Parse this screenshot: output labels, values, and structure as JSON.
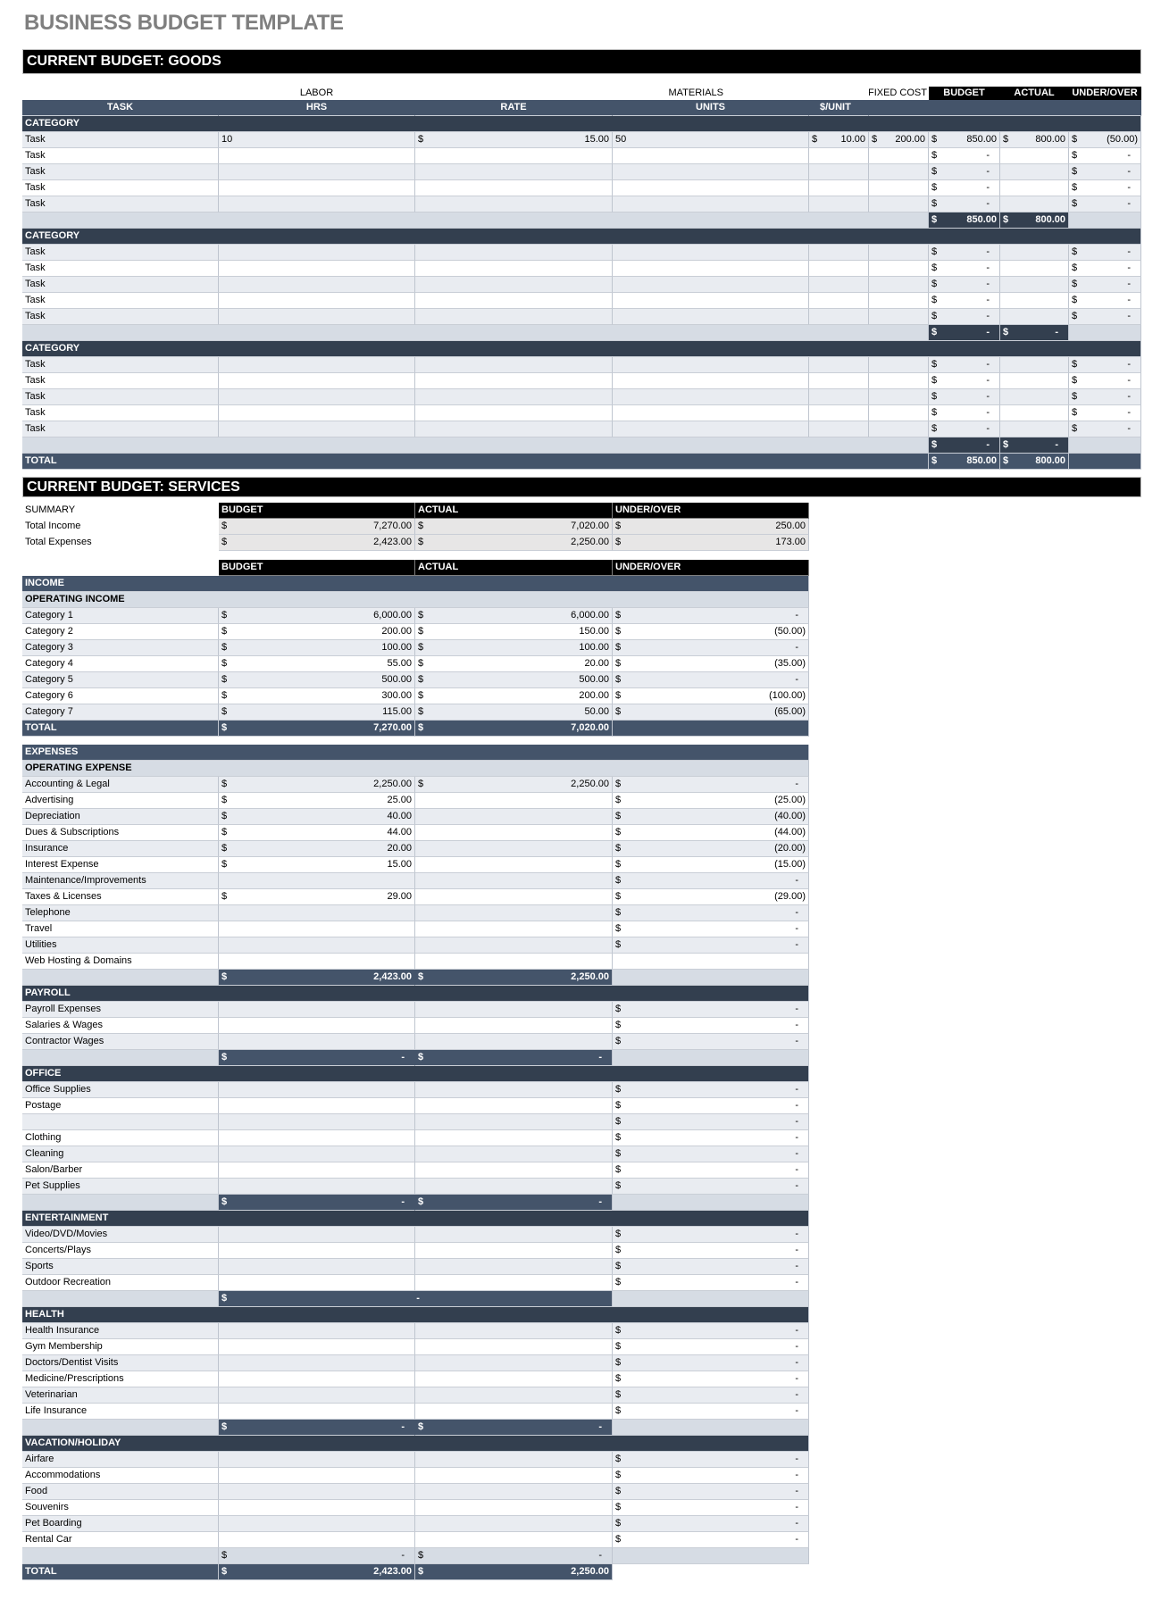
{
  "title": "BUSINESS BUDGET TEMPLATE",
  "goods": {
    "section_title": "CURRENT BUDGET: GOODS",
    "group_labels": {
      "labor": "LABOR",
      "materials": "MATERIALS",
      "fixed_cost": "FIXED COST",
      "budget": "BUDGET",
      "actual": "ACTUAL",
      "under_over": "UNDER/OVER"
    },
    "columns": {
      "task": "TASK",
      "hrs": "HRS",
      "rate": "RATE",
      "units": "UNITS",
      "per_unit": "$/UNIT"
    },
    "categories": [
      {
        "label": "CATEGORY",
        "tasks": [
          {
            "task": "Task",
            "hrs": "10",
            "rate": "15.00",
            "units": "50",
            "per_unit": "10.00",
            "fixed": "200.00",
            "budget": "850.00",
            "actual": "800.00",
            "under_over": "(50.00)"
          },
          {
            "task": "Task",
            "budget": "-",
            "under_over": "-"
          },
          {
            "task": "Task",
            "budget": "-",
            "under_over": "-"
          },
          {
            "task": "Task",
            "budget": "-",
            "under_over": "-"
          },
          {
            "task": "Task",
            "budget": "-",
            "under_over": "-"
          }
        ],
        "subtotal": {
          "budget": "850.00",
          "actual": "800.00"
        }
      },
      {
        "label": "CATEGORY",
        "tasks": [
          {
            "task": "Task",
            "budget": "-",
            "under_over": "-"
          },
          {
            "task": "Task",
            "budget": "-",
            "under_over": "-"
          },
          {
            "task": "Task",
            "budget": "-",
            "under_over": "-"
          },
          {
            "task": "Task",
            "budget": "-",
            "under_over": "-"
          },
          {
            "task": "Task",
            "budget": "-",
            "under_over": "-"
          }
        ],
        "subtotal": {
          "budget": "-",
          "actual": "-"
        }
      },
      {
        "label": "CATEGORY",
        "tasks": [
          {
            "task": "Task",
            "budget": "-",
            "under_over": "-"
          },
          {
            "task": "Task",
            "budget": "-",
            "under_over": "-"
          },
          {
            "task": "Task",
            "budget": "-",
            "under_over": "-"
          },
          {
            "task": "Task",
            "budget": "-",
            "under_over": "-"
          },
          {
            "task": "Task",
            "budget": "-",
            "under_over": "-"
          }
        ],
        "subtotal": {
          "budget": "-",
          "actual": "-"
        }
      }
    ],
    "total": {
      "label": "TOTAL",
      "budget": "850.00",
      "actual": "800.00"
    }
  },
  "services": {
    "section_title": "CURRENT BUDGET: SERVICES",
    "currency": "$",
    "summary": {
      "label": "SUMMARY",
      "headers": {
        "budget": "BUDGET",
        "actual": "ACTUAL",
        "under_over": "UNDER/OVER"
      },
      "rows": [
        {
          "label": "Total Income",
          "budget": "7,270.00",
          "actual": "7,020.00",
          "under_over": "250.00"
        },
        {
          "label": "Total Expenses",
          "budget": "2,423.00",
          "actual": "2,250.00",
          "under_over": "173.00"
        }
      ]
    },
    "headers": {
      "budget": "BUDGET",
      "actual": "ACTUAL",
      "under_over": "UNDER/OVER"
    },
    "income": {
      "label": "INCOME",
      "group_label": "OPERATING INCOME",
      "rows": [
        {
          "label": "Category 1",
          "budget": "6,000.00",
          "actual": "6,000.00",
          "under_over": "-"
        },
        {
          "label": "Category 2",
          "budget": "200.00",
          "actual": "150.00",
          "under_over": "(50.00)"
        },
        {
          "label": "Category 3",
          "budget": "100.00",
          "actual": "100.00",
          "under_over": "-"
        },
        {
          "label": "Category 4",
          "budget": "55.00",
          "actual": "20.00",
          "under_over": "(35.00)"
        },
        {
          "label": "Category 5",
          "budget": "500.00",
          "actual": "500.00",
          "under_over": "-"
        },
        {
          "label": "Category 6",
          "budget": "300.00",
          "actual": "200.00",
          "under_over": "(100.00)"
        },
        {
          "label": "Category 7",
          "budget": "115.00",
          "actual": "50.00",
          "under_over": "(65.00)"
        }
      ],
      "total": {
        "label": "TOTAL",
        "budget": "7,270.00",
        "actual": "7,020.00"
      }
    },
    "expenses": {
      "label": "EXPENSES",
      "groups": [
        {
          "label": "OPERATING EXPENSE",
          "style": "light",
          "rows": [
            {
              "label": "Accounting & Legal",
              "budget": "2,250.00",
              "actual": "2,250.00",
              "under_over": "-"
            },
            {
              "label": "Advertising",
              "budget": "25.00",
              "under_over": "(25.00)"
            },
            {
              "label": "Depreciation",
              "budget": "40.00",
              "under_over": "(40.00)"
            },
            {
              "label": "Dues & Subscriptions",
              "budget": "44.00",
              "under_over": "(44.00)"
            },
            {
              "label": "Insurance",
              "budget": "20.00",
              "under_over": "(20.00)"
            },
            {
              "label": "Interest Expense",
              "budget": "15.00",
              "under_over": "(15.00)"
            },
            {
              "label": "Maintenance/Improvements",
              "under_over": "-"
            },
            {
              "label": "Taxes & Licenses",
              "budget": "29.00",
              "under_over": "(29.00)"
            },
            {
              "label": "Telephone",
              "under_over": "-"
            },
            {
              "label": "Travel",
              "under_over": "-"
            },
            {
              "label": "Utilities",
              "under_over": "-"
            },
            {
              "label": "Web Hosting & Domains"
            }
          ],
          "subtotal": {
            "budget": "2,423.00",
            "actual": "2,250.00",
            "style": "split"
          }
        },
        {
          "label": "PAYROLL",
          "style": "dark",
          "rows": [
            {
              "label": "Payroll Expenses",
              "under_over": "-"
            },
            {
              "label": "Salaries & Wages",
              "under_over": "-"
            },
            {
              "label": "Contractor Wages",
              "under_over": "-"
            }
          ],
          "subtotal": {
            "budget": "-",
            "actual": "-",
            "style": "split"
          }
        },
        {
          "label": "OFFICE",
          "style": "dark",
          "rows": [
            {
              "label": "Office Supplies",
              "under_over": "-"
            },
            {
              "label": "Postage",
              "under_over": "-"
            },
            {
              "label": "",
              "under_over": "-"
            },
            {
              "label": "Clothing",
              "under_over": "-"
            },
            {
              "label": "Cleaning",
              "under_over": "-"
            },
            {
              "label": "Salon/Barber",
              "under_over": "-"
            },
            {
              "label": "Pet Supplies",
              "under_over": "-"
            }
          ],
          "subtotal": {
            "budget": "-",
            "actual": "-",
            "style": "split"
          }
        },
        {
          "label": "ENTERTAINMENT",
          "style": "dark",
          "rows": [
            {
              "label": "Video/DVD/Movies",
              "under_over": "-"
            },
            {
              "label": "Concerts/Plays",
              "under_over": "-"
            },
            {
              "label": "Sports",
              "under_over": "-"
            },
            {
              "label": "Outdoor Recreation",
              "under_over": "-"
            }
          ],
          "subtotal": {
            "budget": "-",
            "style": "merged"
          }
        },
        {
          "label": "HEALTH",
          "style": "dark",
          "rows": [
            {
              "label": "Health Insurance",
              "under_over": "-"
            },
            {
              "label": "Gym Membership",
              "under_over": "-"
            },
            {
              "label": "Doctors/Dentist Visits",
              "under_over": "-"
            },
            {
              "label": "Medicine/Prescriptions",
              "under_over": "-"
            },
            {
              "label": "Veterinarian",
              "under_over": "-"
            },
            {
              "label": "Life Insurance",
              "under_over": "-"
            }
          ],
          "subtotal": {
            "budget": "-",
            "actual": "-",
            "style": "split"
          }
        },
        {
          "label": "VACATION/HOLIDAY",
          "style": "dark",
          "rows": [
            {
              "label": "Airfare",
              "under_over": "-"
            },
            {
              "label": "Accommodations",
              "under_over": "-"
            },
            {
              "label": "Food",
              "under_over": "-"
            },
            {
              "label": "Souvenirs",
              "under_over": "-"
            },
            {
              "label": "Pet Boarding",
              "under_over": "-"
            },
            {
              "label": "Rental Car",
              "under_over": "-"
            }
          ],
          "subtotal": {
            "budget": "-",
            "actual": "-",
            "style": "plain"
          }
        }
      ],
      "total": {
        "label": "TOTAL",
        "budget": "2,423.00",
        "actual": "2,250.00"
      }
    }
  }
}
